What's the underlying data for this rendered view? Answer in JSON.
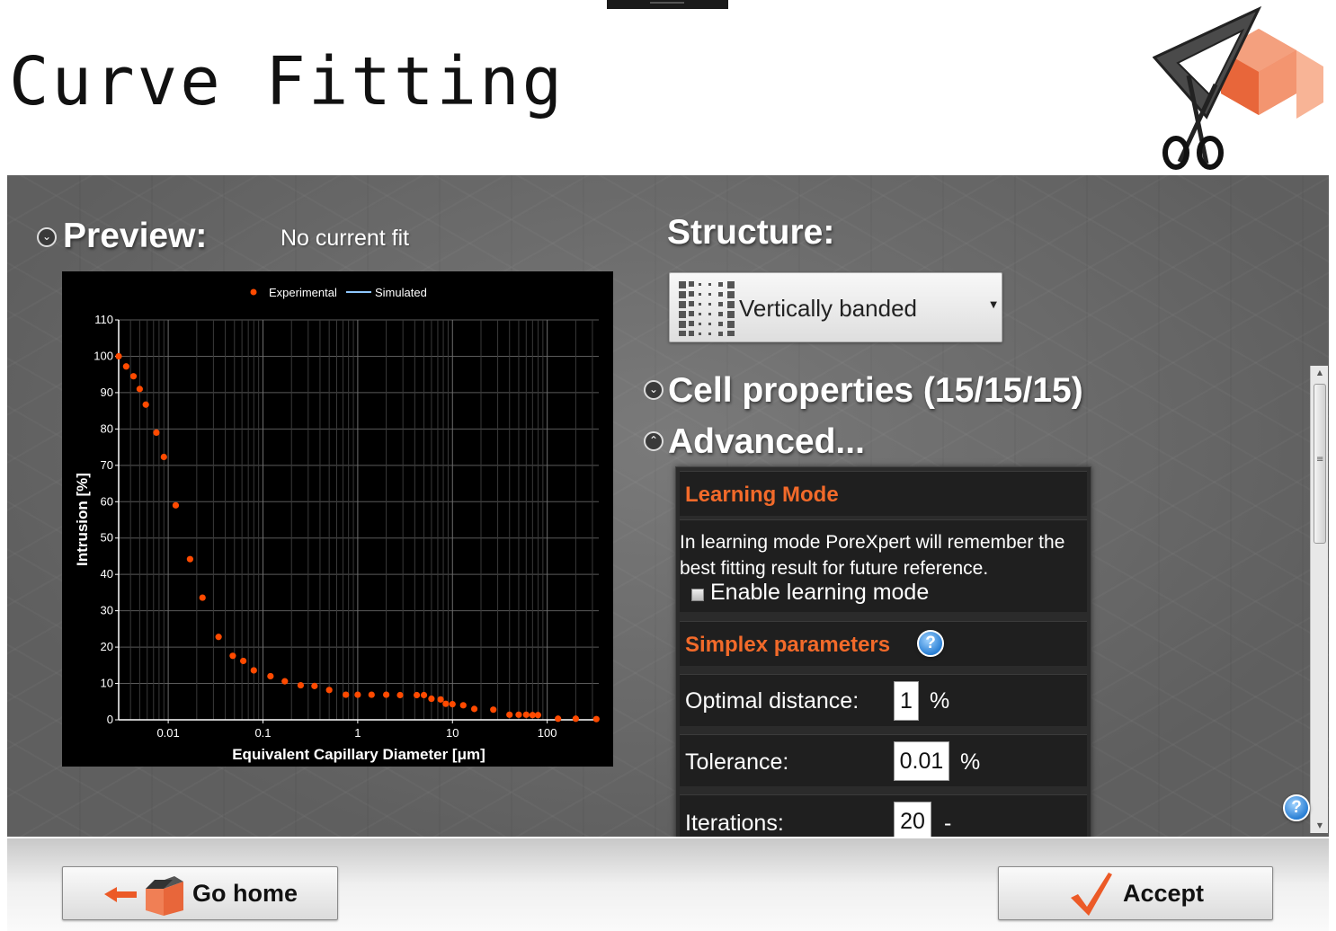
{
  "app": {
    "title": "Curve Fitting"
  },
  "preview": {
    "heading": "Preview:",
    "status": "No current fit"
  },
  "structure": {
    "heading": "Structure:",
    "selected": "Vertically banded"
  },
  "cell_properties": {
    "heading": "Cell properties (15/15/15)"
  },
  "advanced": {
    "heading": "Advanced...",
    "learning_mode": {
      "heading": "Learning Mode",
      "description_line1": "In learning mode PoreXpert will remember the",
      "description_line2": "best fitting result for future reference.",
      "checkbox_label": "Enable learning mode",
      "checked": false
    },
    "simplex": {
      "heading": "Simplex parameters",
      "help": "?",
      "optimal_distance_label": "Optimal distance:",
      "optimal_distance_value": "1",
      "optimal_distance_unit": "%",
      "tolerance_label": "Tolerance:",
      "tolerance_value": "0.01",
      "tolerance_unit": "%",
      "iterations_label": "Iterations:",
      "iterations_value": "20",
      "iterations_unit": "-"
    }
  },
  "help_badge": "?",
  "buttons": {
    "go_home": "Go home",
    "accept": "Accept"
  },
  "colors": {
    "accent": "#f26a2a",
    "point": "#ff4a00",
    "simulated_line": "#8fc8ff",
    "panel_bg": "#6b6b6b"
  },
  "chart_data": {
    "type": "scatter",
    "xlabel": "Equivalent Capillary Diameter [μm]",
    "ylabel": "Intrusion [%]",
    "x_scale": "log",
    "xlim": [
      0.003,
      350
    ],
    "ylim": [
      0,
      110
    ],
    "x_ticks": [
      {
        "value": 0.01,
        "label": "0.01"
      },
      {
        "value": 0.1,
        "label": "0.1"
      },
      {
        "value": 1,
        "label": "1"
      },
      {
        "value": 10,
        "label": "10"
      },
      {
        "value": 100,
        "label": "100"
      }
    ],
    "y_ticks": [
      0,
      10,
      20,
      30,
      40,
      50,
      60,
      70,
      80,
      90,
      100,
      110
    ],
    "grid": true,
    "legend_position": "top-center",
    "series": [
      {
        "name": "Experimental",
        "kind": "points",
        "x": [
          0.003,
          0.0036,
          0.0043,
          0.005,
          0.0058,
          0.0075,
          0.009,
          0.012,
          0.017,
          0.023,
          0.034,
          0.048,
          0.062,
          0.08,
          0.12,
          0.17,
          0.25,
          0.35,
          0.5,
          0.75,
          1,
          1.4,
          2,
          2.8,
          4.2,
          5,
          6,
          7.5,
          8.5,
          10,
          13,
          17,
          27,
          40,
          50,
          60,
          70,
          80,
          130,
          200,
          330
        ],
        "y": [
          100,
          97.2,
          94.5,
          91,
          86.7,
          79,
          72.3,
          59,
          44.2,
          33.6,
          22.8,
          17.6,
          16.2,
          13.6,
          12,
          10.6,
          9.5,
          9.3,
          8.2,
          6.9,
          6.9,
          6.9,
          6.9,
          6.8,
          6.8,
          6.8,
          5.8,
          5.6,
          4.4,
          4.3,
          4,
          3,
          2.8,
          1.4,
          1.4,
          1.4,
          1.3,
          1.3,
          0.3,
          0.3,
          0.2
        ]
      },
      {
        "name": "Simulated",
        "kind": "line",
        "x": [],
        "y": []
      }
    ]
  }
}
